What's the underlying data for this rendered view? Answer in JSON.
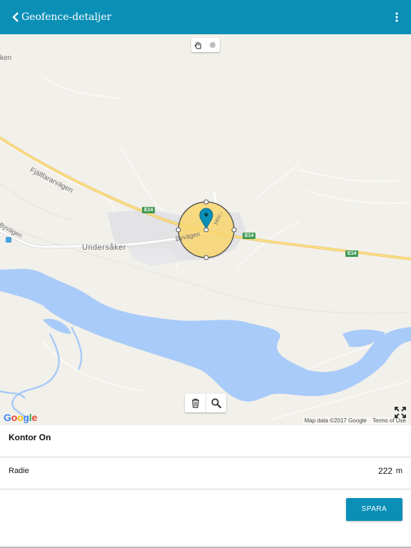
{
  "app": {
    "title": "Geofence-detaljer",
    "icons": {
      "back": "chevron-left-icon",
      "more": "more-vert-icon"
    },
    "accent": "#0a8fb7"
  },
  "map": {
    "labels": {
      "top_left": "ken",
      "road_fjallfarar": "Fjällfararvägen",
      "road_byvagen_left": "Byvägen",
      "road_byvagen": "Byvägen",
      "village": "Undersåker",
      "road_hov": "Hov..."
    },
    "shields": [
      "E14",
      "E14",
      "E14"
    ],
    "mode_icons": [
      "hand-pan-icon",
      "dot-draw-icon"
    ],
    "tool_icons": [
      "trash-icon",
      "search-icon"
    ],
    "google_logo": "Google",
    "attribution": {
      "data": "Map data ©2017 Google",
      "terms": "Terms of Use"
    },
    "fullscreen_icon": "fullscreen-icon",
    "colors": {
      "land": "#f2f0ea",
      "water": "#a9cbf9",
      "road": "#f7d06a",
      "fence": "#f9d66e"
    }
  },
  "form": {
    "name": "Kontor On",
    "radius_label": "Radie",
    "radius_value": "222",
    "radius_unit": "m",
    "save_label": "SPARA"
  }
}
